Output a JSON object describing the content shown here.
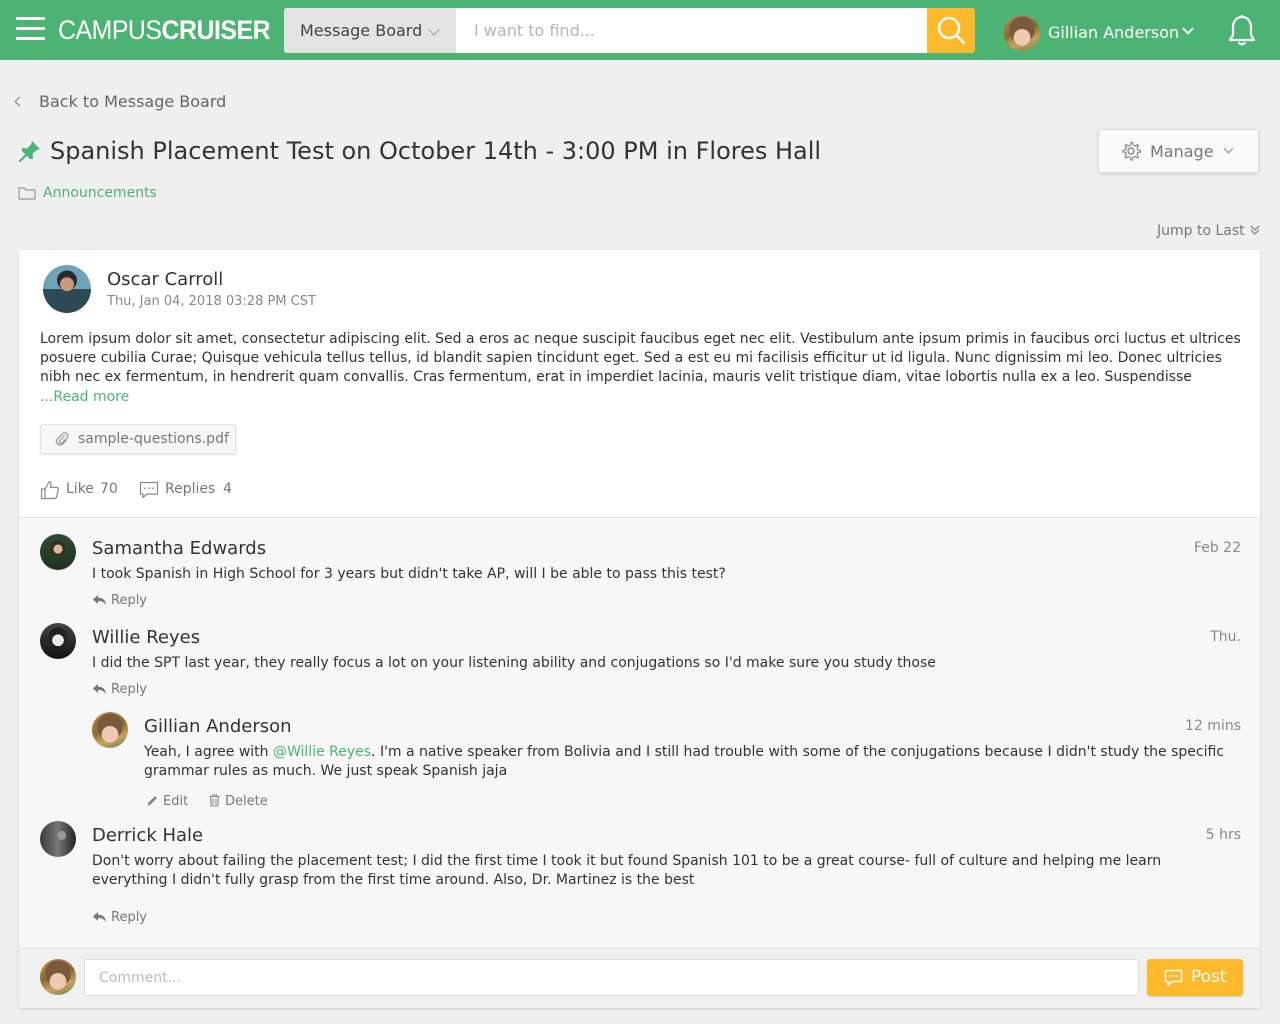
{
  "header": {
    "logo_light": "CAMPUS",
    "logo_bold": "CRUISER",
    "scope_label": "Message Board",
    "search_placeholder": "I want to find...",
    "user_name": "Gillian Anderson"
  },
  "nav": {
    "back_label": "Back to Message Board"
  },
  "thread": {
    "title": "Spanish Placement Test on October 14th - 3:00 PM in Flores Hall",
    "category": "Announcements",
    "manage_label": "Manage",
    "jump_label": "Jump to Last"
  },
  "post": {
    "author": "Oscar Carroll",
    "date": "Thu, Jan 04, 2018 03:28 PM CST",
    "body": "Lorem ipsum dolor sit amet, consectetur adipiscing elit. Sed a eros ac neque suscipit faucibus eget nec elit. Vestibulum ante ipsum primis in faucibus orci luctus et ultrices posuere cubilia Curae; Quisque vehicula tellus tellus, id blandit sapien tincidunt eget. Sed a est eu mi facilisis efficitur ut id ligula. Nunc dignissim mi leo. Donec ultricies nibh nec ex fermentum, in hendrerit quam convallis. Cras fermentum, erat in imperdiet lacinia, mauris velit tristique diam, vitae lobortis nulla ex a leo. Suspendisse ullamcorper ante in lacus rhoncus, et tincidunt",
    "read_more": "...Read more",
    "attachment": "sample-questions.pdf",
    "like_label": "Like",
    "like_count": "70",
    "replies_label": "Replies",
    "replies_count": "4"
  },
  "replies": [
    {
      "author": "Samantha Edwards",
      "time": "Feb 22",
      "text": "I took Spanish in High School for 3 years but didn't take AP, will I be able to pass this test?",
      "action": "Reply"
    },
    {
      "author": "Willie Reyes",
      "time": "Thu.",
      "text": "I did the SPT last year, they really focus a lot on your listening ability and conjugations so I'd make sure you study those",
      "action": "Reply"
    },
    {
      "author": "Gillian Anderson",
      "time": "12 mins",
      "text_before": "Yeah, I agree with ",
      "mention": "@Willie Reyes",
      "text_after": ". I'm a native speaker from Bolivia and I still had trouble with some of the conjugations because I didn't study the specific grammar rules as much. We just speak Spanish jaja",
      "edit_label": "Edit",
      "delete_label": "Delete"
    },
    {
      "author": "Derrick Hale",
      "time": "5 hrs",
      "text": "Don't worry about failing the placement test; I did the first time I took it but found Spanish 101 to be a great course- full of culture and helping me learn everything I didn't fully grasp from the first time around. Also, Dr. Martinez is the best",
      "action": "Reply"
    }
  ],
  "composer": {
    "placeholder": "Comment...",
    "post_label": "Post"
  },
  "colors": {
    "brand_green": "#4cb374",
    "accent_yellow": "#fcb92c"
  }
}
